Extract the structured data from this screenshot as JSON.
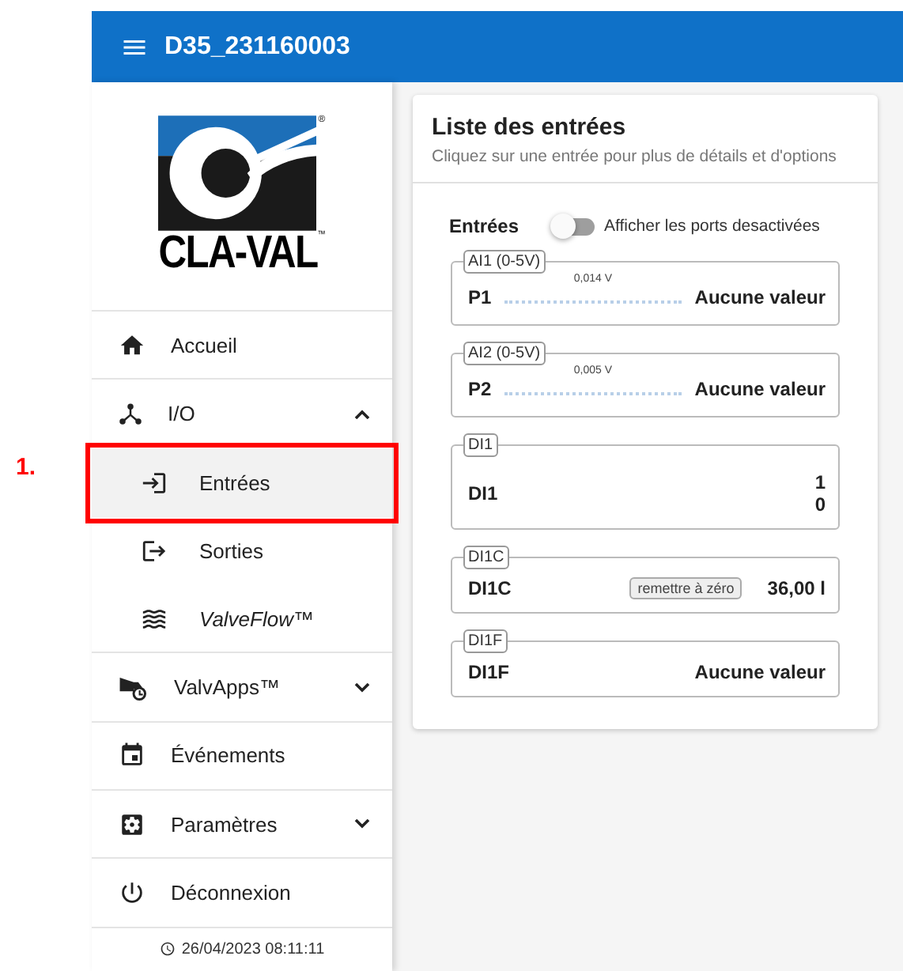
{
  "annotation": {
    "label": "1."
  },
  "top_bar": {
    "title": "D35_231160003"
  },
  "logo": {
    "text": "CLA-VAL",
    "registered": "®",
    "trademark": "™"
  },
  "sidebar": {
    "items": [
      {
        "label": "Accueil",
        "selected": false
      },
      {
        "label": "I/O",
        "selected": false,
        "expanded": true,
        "children": [
          {
            "label": "Entrées",
            "selected": true,
            "italic": false,
            "annotated": true
          },
          {
            "label": "Sorties",
            "selected": false,
            "italic": false,
            "annotated": false
          },
          {
            "label": "ValveFlow™",
            "selected": false,
            "italic": true,
            "annotated": false
          }
        ]
      },
      {
        "label": "ValvApps™",
        "selected": false,
        "expanded": false
      },
      {
        "label": "Événements",
        "selected": false
      },
      {
        "label": "Paramètres",
        "selected": false,
        "expanded": false
      },
      {
        "label": "Déconnexion",
        "selected": false
      }
    ],
    "timestamp": "26/04/2023 08:11:11"
  },
  "card": {
    "title": "Liste des entrées",
    "subtitle": "Cliquez sur une entrée pour plus de détails et d'options",
    "section_label": "Entrées",
    "toggle": {
      "label": "Afficher les ports desactivées",
      "on": false
    },
    "ports": [
      {
        "kind": "analog",
        "legend": "AI1 (0-5V)",
        "name": "P1",
        "reading": "0,014 V",
        "value": "Aucune valeur"
      },
      {
        "kind": "analog",
        "legend": "AI2 (0-5V)",
        "name": "P2",
        "reading": "0,005 V",
        "value": "Aucune valeur"
      },
      {
        "kind": "digital",
        "legend": "DI1",
        "name": "DI1",
        "values": [
          "1",
          "0"
        ]
      },
      {
        "kind": "counter",
        "legend": "DI1C",
        "name": "DI1C",
        "button": "remettre à zéro",
        "value": "36,00 l"
      },
      {
        "kind": "plain",
        "legend": "DI1F",
        "name": "DI1F",
        "value": "Aucune valeur"
      }
    ]
  }
}
